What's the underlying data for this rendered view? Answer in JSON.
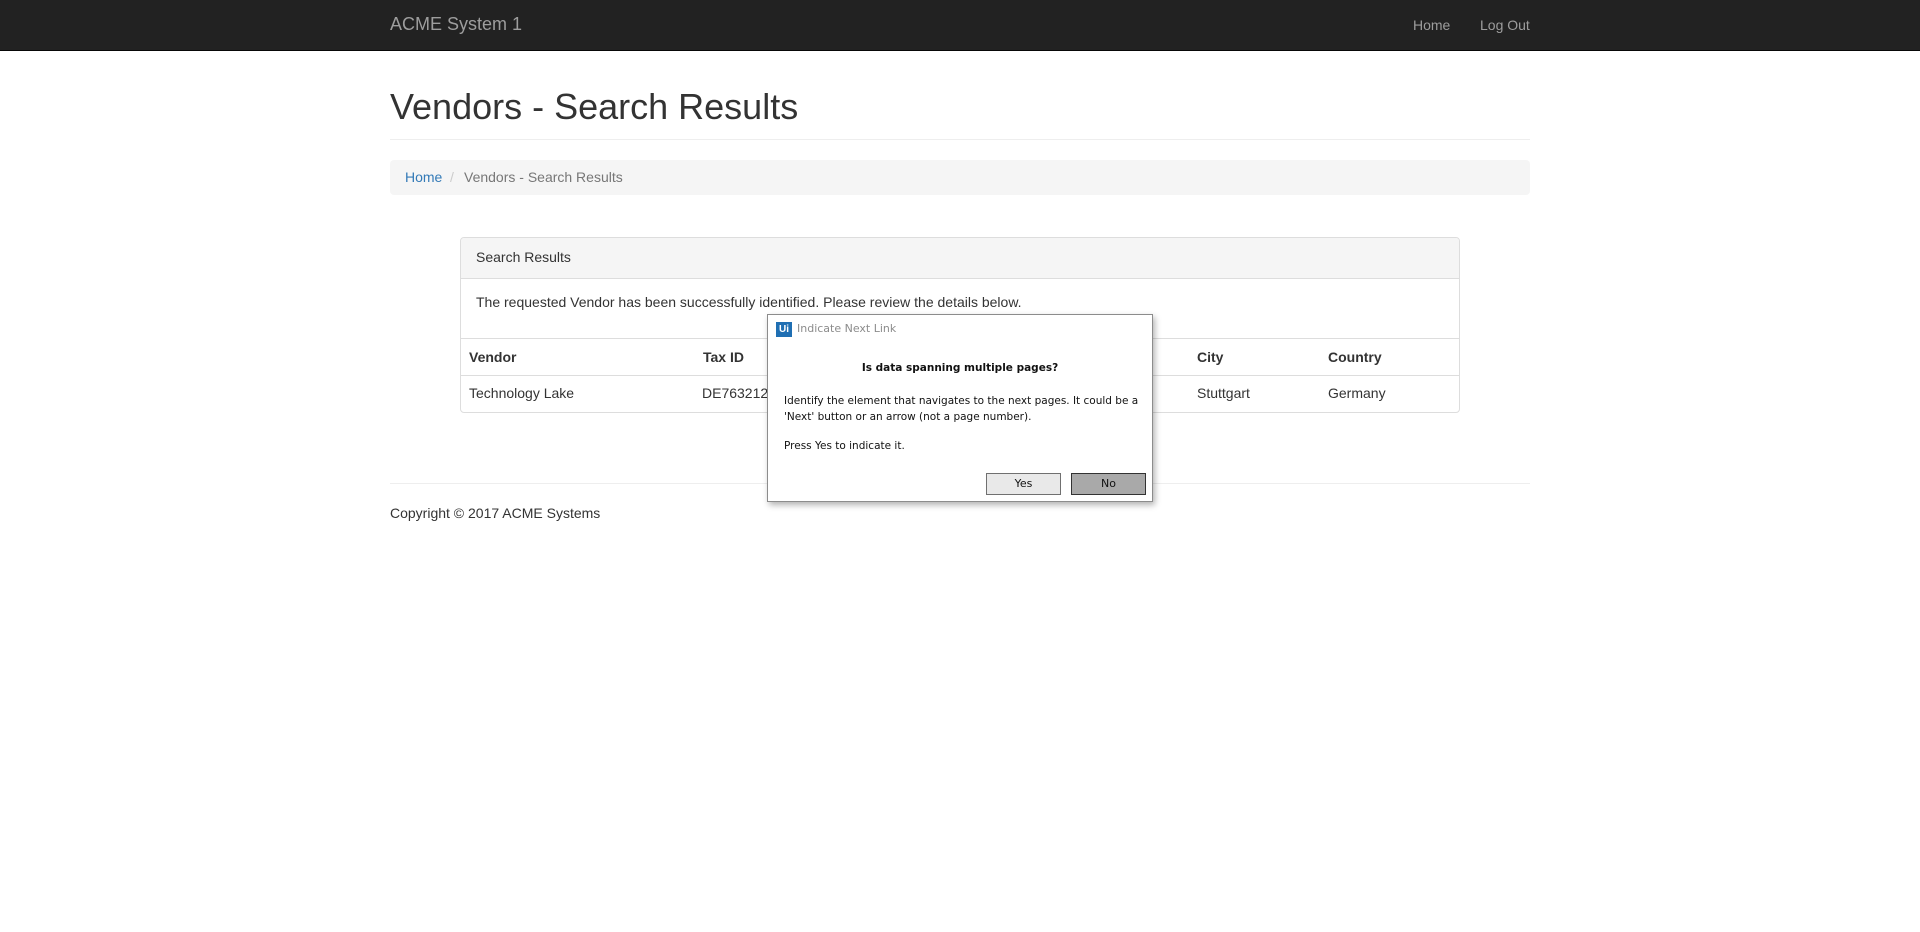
{
  "navbar": {
    "brand": "ACME System 1",
    "home": "Home",
    "logout": "Log Out"
  },
  "page": {
    "title": "Vendors - Search Results"
  },
  "breadcrumb": {
    "home": "Home",
    "separator": "/",
    "current": "Vendors - Search Results"
  },
  "panel": {
    "heading": "Search Results",
    "message": "The requested Vendor has been successfully identified. Please review the details below.",
    "columns": [
      "Vendor",
      "Tax ID",
      "City",
      "Country"
    ],
    "row": [
      "Technology Lake",
      "DE763212",
      "Stuttgart",
      "Germany"
    ]
  },
  "footer": {
    "copyright": "Copyright © 2017 ACME Systems"
  },
  "dialog": {
    "logo": "Ui",
    "title": "Indicate Next Link",
    "heading": "Is data spanning multiple pages?",
    "body": "Identify the element that navigates to the next pages. It could be a 'Next' button or an arrow (not a page number).",
    "press": "Press Yes to indicate it.",
    "yes": "Yes",
    "no": "No"
  }
}
